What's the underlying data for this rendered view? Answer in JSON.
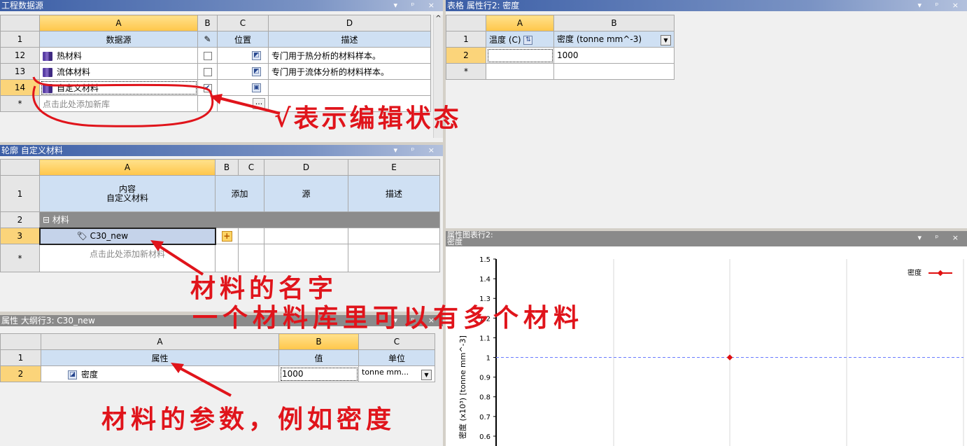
{
  "data_sources": {
    "title": "工程数据源",
    "columns": [
      "A",
      "B",
      "C",
      "D"
    ],
    "header_row": {
      "num": "1",
      "a": "数据源",
      "c": "位置",
      "d": "描述"
    },
    "rows": [
      {
        "num": "12",
        "name": "热材料",
        "desc": "专门用于热分析的材料样本。"
      },
      {
        "num": "13",
        "name": "流体材料",
        "desc": "专门用于流体分析的材料样本。"
      },
      {
        "num": "14",
        "name": "自定义材料",
        "desc": ""
      }
    ],
    "add_row": {
      "num": "*",
      "label": "点击此处添加新库",
      "button": "..."
    }
  },
  "outline": {
    "title": "轮廓 自定义材料",
    "columns": [
      "A",
      "B",
      "C",
      "D",
      "E"
    ],
    "header": {
      "num": "1",
      "a_line1": "内容",
      "a_line2": "自定义材料",
      "bc": "添加",
      "d": "源",
      "e": "描述"
    },
    "group": {
      "num": "2",
      "label": "材料"
    },
    "material": {
      "num": "3",
      "name": "C30_new"
    },
    "add_row": {
      "num": "*",
      "label": "点击此处添加新材料"
    }
  },
  "properties": {
    "title": "属性 大纲行3:  C30_new",
    "columns": [
      "A",
      "B",
      "C"
    ],
    "header": {
      "num": "1",
      "a": "属性",
      "b": "值",
      "c": "单位"
    },
    "row": {
      "num": "2",
      "name": "密度",
      "value": "1000",
      "unit": "tonne mm..."
    }
  },
  "table": {
    "title": "表格 属性行2:  密度",
    "columns": [
      "A",
      "B"
    ],
    "header": {
      "num": "1",
      "a": "温度 (C)",
      "b": "密度 (tonne mm^-3)"
    },
    "row": {
      "num": "2",
      "b": "1000"
    },
    "add_row": {
      "num": "*"
    }
  },
  "chart_panel": {
    "title_line1": "属性图表行2:",
    "title_line2": "密度"
  },
  "chart_data": {
    "type": "line",
    "ylabel": "密度  (x10³)  [tonne mm^-3]",
    "legend": "密度",
    "ylim": [
      0.55,
      1.5
    ],
    "yticks": [
      "1.5",
      "1.4",
      "1.3",
      "1.2",
      "1.1",
      "1",
      "0.9",
      "0.8",
      "0.7",
      "0.6"
    ],
    "series": [
      {
        "name": "密度",
        "x": [
          0
        ],
        "y": [
          1
        ],
        "color": "#e01010"
      }
    ]
  },
  "annotations": {
    "edit_state": "√表示编辑状态",
    "material_name": "材料的名字",
    "multi_material": "一个材料库里可以有多个材料",
    "material_param": "材料的参数，例如密度"
  },
  "window_controls": "▾ ᵖ ×",
  "colors": {
    "annotation": "#e0141b",
    "title_bar": "#3b5ea6"
  }
}
